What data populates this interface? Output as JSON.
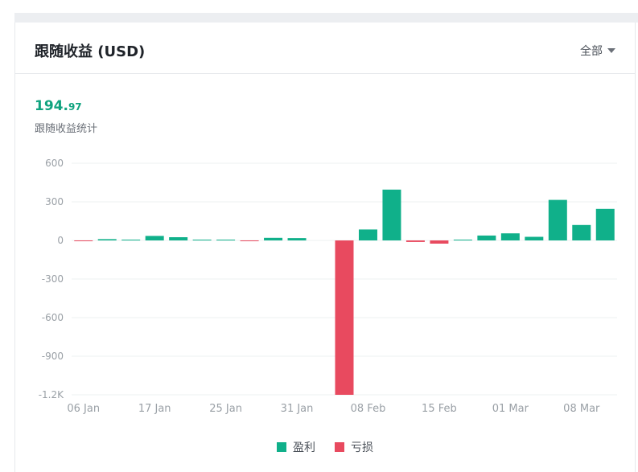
{
  "header": {
    "title": "跟随收益 (USD)",
    "filter_label": "全部"
  },
  "summary": {
    "total_int": "194.",
    "total_dec": "97",
    "label": "跟随收益统计"
  },
  "colors": {
    "profit": "#10b08a",
    "loss": "#e84a5f",
    "accent": "#10a37f",
    "grid": "#eef0f2",
    "axis_text": "#9aa0a6"
  },
  "legend": {
    "profit_label": "盈利",
    "loss_label": "亏损"
  },
  "chart_data": {
    "type": "bar",
    "ylim": [
      -1200,
      600
    ],
    "y_ticks": [
      600,
      300,
      0,
      -300,
      -600,
      -900,
      -1200
    ],
    "y_tick_labels": [
      "600",
      "300",
      "0",
      "-300",
      "-600",
      "-900",
      "-1.2K"
    ],
    "x_tick_labels": [
      "06 Jan",
      "17 Jan",
      "25 Jan",
      "31 Jan",
      "08 Feb",
      "15 Feb",
      "01 Mar",
      "08 Mar"
    ],
    "x_tick_bar_index": [
      0,
      3,
      6,
      9,
      12,
      15,
      18,
      21
    ],
    "values": [
      -4,
      10,
      6,
      35,
      25,
      3,
      5,
      -5,
      20,
      18,
      0,
      -1200,
      85,
      395,
      -12,
      -25,
      5,
      38,
      55,
      28,
      315,
      120,
      245
    ]
  }
}
